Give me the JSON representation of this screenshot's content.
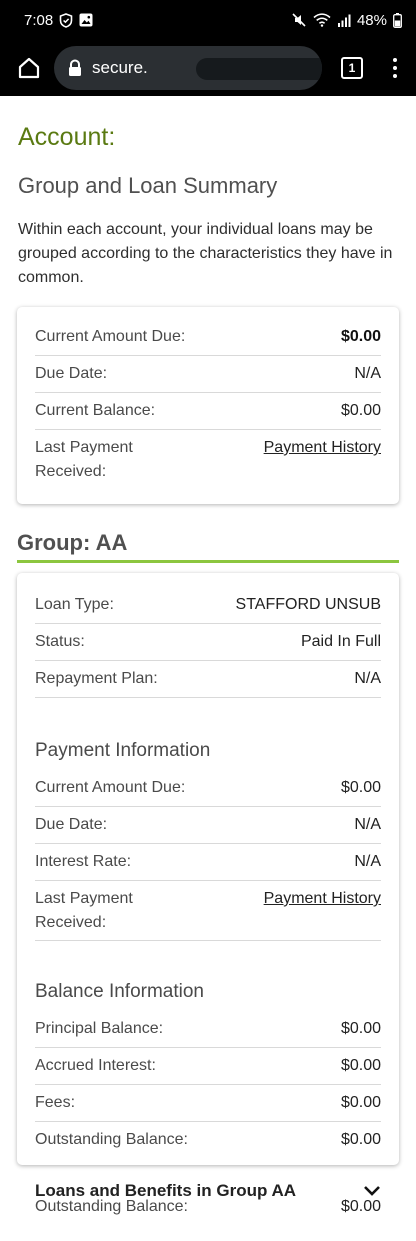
{
  "status_bar": {
    "time": "7:08",
    "battery": "48%",
    "icons": [
      "shield-icon",
      "image-icon",
      "mute-icon",
      "wifi-icon",
      "signal-icon",
      "battery-icon"
    ]
  },
  "browser": {
    "url": "secure.",
    "tab_count": "1"
  },
  "page": {
    "account_title": "Account:",
    "summary_title": "Group and Loan Summary",
    "intro": "Within each account, your individual loans may be grouped according to the characteristics they have in common."
  },
  "summary_card": {
    "current_amount_due_label": "Current Amount Due:",
    "current_amount_due_value": "$0.00",
    "due_date_label": "Due Date:",
    "due_date_value": "N/A",
    "current_balance_label": "Current Balance:",
    "current_balance_value": "$0.00",
    "last_payment_label_line1": "Last Payment",
    "last_payment_label_line2": "Received:",
    "payment_history_link": "Payment History"
  },
  "group": {
    "title": "Group: AA",
    "loan_type_label": "Loan Type:",
    "loan_type_value": "STAFFORD UNSUB",
    "status_label": "Status:",
    "status_value": "Paid In Full",
    "repayment_plan_label": "Repayment Plan:",
    "repayment_plan_value": "N/A",
    "payment_info_title": "Payment Information",
    "current_amount_due_label": "Current Amount Due:",
    "current_amount_due_value": "$0.00",
    "due_date_label": "Due Date:",
    "due_date_value": "N/A",
    "interest_rate_label": "Interest Rate:",
    "interest_rate_value": "N/A",
    "last_payment_label_line1": "Last Payment",
    "last_payment_label_line2": "Received:",
    "payment_history_link": "Payment History",
    "balance_info_title": "Balance Information",
    "principal_balance_label": "Principal Balance:",
    "principal_balance_value": "$0.00",
    "accrued_interest_label": "Accrued Interest:",
    "accrued_interest_value": "$0.00",
    "fees_label": "Fees:",
    "fees_value": "$0.00",
    "outstanding_balance_label": "Outstanding Balance:",
    "outstanding_balance_value": "$0.00"
  },
  "loans_section": {
    "title": "Loans and Benefits in Group AA",
    "partial_label": "Outstanding Balance:",
    "partial_value": "$0.00"
  }
}
